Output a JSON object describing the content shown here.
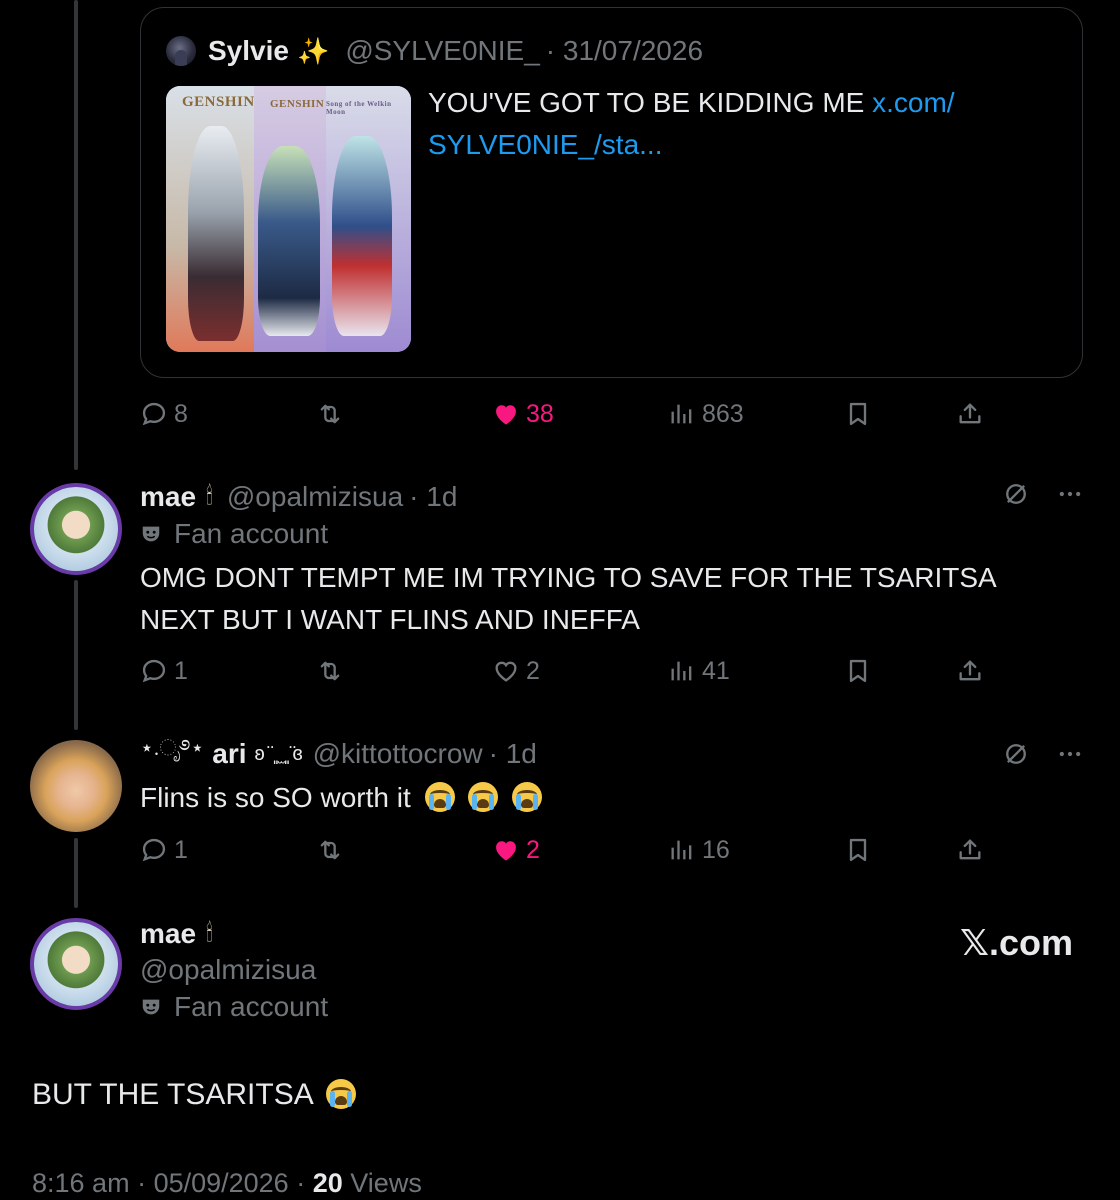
{
  "quote": {
    "author_name": "Sylvie",
    "author_emoji": "✨",
    "handle": "@SYLVE0NIE_",
    "date": "· 31/07/2026",
    "text": "YOU'VE GOT TO BE KIDDING ME",
    "link_line1": "x.com/",
    "link_line2": "SYLVE0NIE_/sta...",
    "thumb_labels": [
      "GENSHIN",
      "GENSHIN",
      "Song of the Welkin Moon"
    ]
  },
  "main_actions": {
    "replies": "8",
    "likes": "38",
    "views": "863",
    "liked": true
  },
  "reply1": {
    "name": "mae",
    "emoji": "🕯",
    "handle": "@opalmizisua",
    "time": "· 1d",
    "fan_label": "Fan account",
    "text_line1": "OMG DONT TEMPT ME IM TRYING TO SAVE FOR THE TSARITSA",
    "text_line2": "NEXT BUT I WANT FLINS AND INEFFA",
    "replies": "1",
    "likes": "2",
    "views": "41"
  },
  "reply2": {
    "name_prefix": "⋆.ೃ࿔⋆",
    "name": "ari",
    "name_suffix": "ʚ ̈ ͈ ̫ ͈ ̈ɞ",
    "handle": "@kittottocrow",
    "time": "· 1d",
    "text": "Flins is so SO worth it",
    "replies": "1",
    "likes": "2",
    "views": "16"
  },
  "focus": {
    "name": "mae",
    "emoji": "🕯",
    "handle": "@opalmizisua",
    "fan_label": "Fan account",
    "brand": "𝕏.com",
    "text": "BUT THE TSARITSA",
    "time": "8:16 am",
    "date": "· 05/09/2026 ·",
    "views_count": "20",
    "views_label": "Views"
  },
  "colors": {
    "like_pink": "#f91880",
    "link_blue": "#1d9bf0",
    "muted": "#71767b",
    "text": "#e7e9ea",
    "border": "#2f3336"
  },
  "icons": [
    "reply-icon",
    "retweet-icon",
    "heart-icon",
    "views-icon",
    "bookmark-icon",
    "share-icon",
    "grok-icon",
    "more-icon",
    "fan-mask-icon",
    "loudly-crying-emoji"
  ]
}
